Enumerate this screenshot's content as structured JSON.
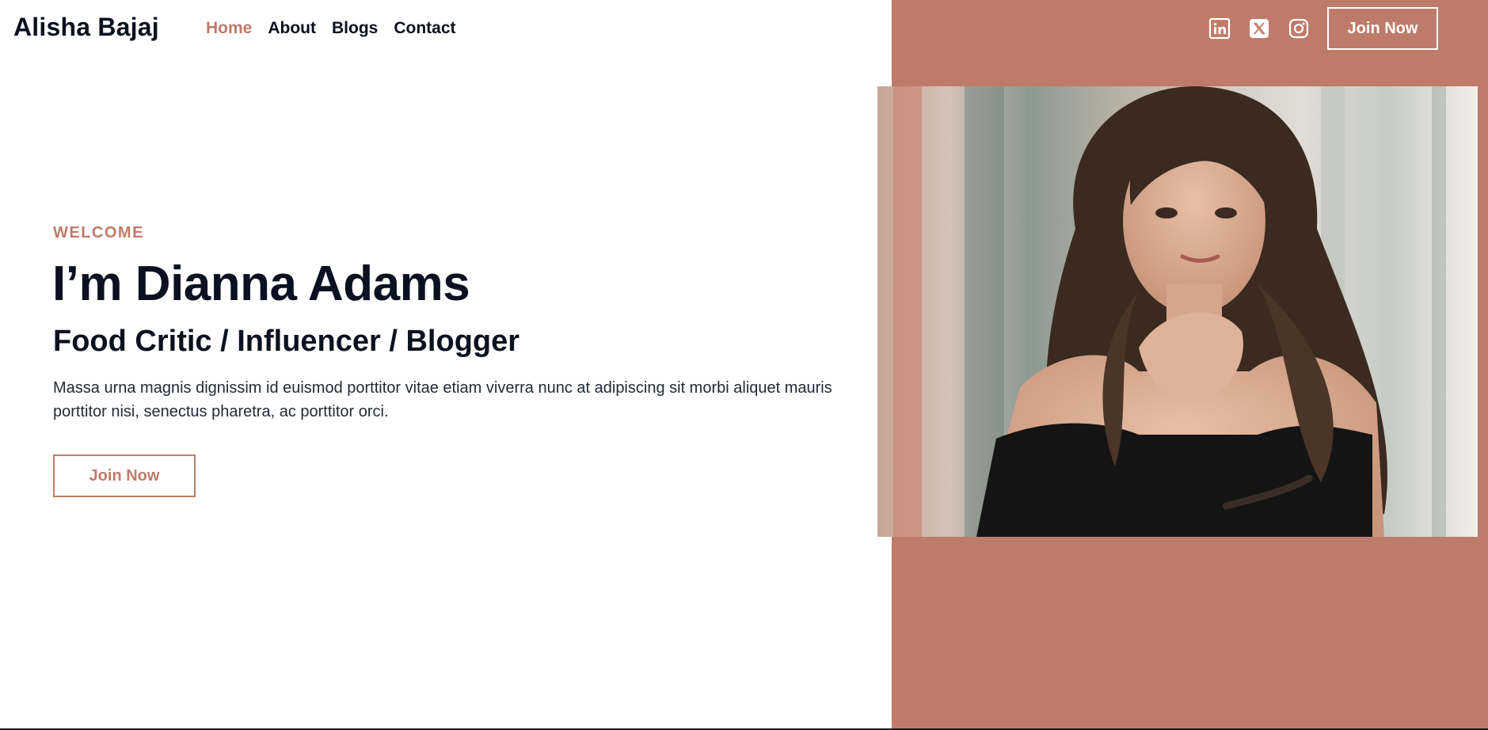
{
  "brand": {
    "name": "Alisha Bajaj"
  },
  "nav": {
    "items": [
      {
        "label": "Home",
        "active": true
      },
      {
        "label": "About",
        "active": false
      },
      {
        "label": "Blogs",
        "active": false
      },
      {
        "label": "Contact",
        "active": false
      }
    ]
  },
  "header": {
    "social_icons": [
      "linkedin-icon",
      "x-icon",
      "instagram-icon"
    ],
    "join_label": "Join Now"
  },
  "hero": {
    "eyebrow": "WELCOME",
    "title": "I’m Dianna Adams",
    "subtitle": "Food Critic / Influencer / Blogger",
    "description": "Massa urna magnis dignissim id euismod porttitor vitae etiam viverra nunc at adipiscing sit morbi aliquet mauris porttitor nisi, senectus pharetra, ac porttitor orci.",
    "cta_label": "Join Now"
  },
  "colors": {
    "accent": "#bf7b69",
    "text": "#0b1120",
    "background": "#ffffff"
  }
}
